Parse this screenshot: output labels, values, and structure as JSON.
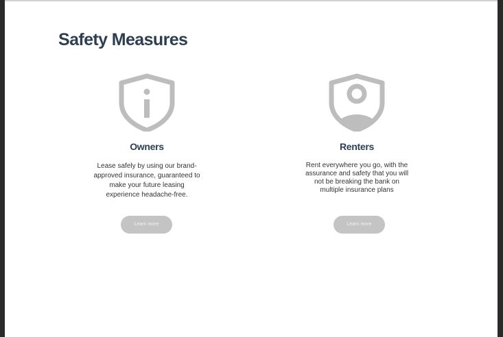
{
  "page": {
    "title": "Safety Measures"
  },
  "cards": [
    {
      "icon": "info-shield-icon",
      "title": "Owners",
      "description": "Lease safely by using our brand-approved insurance, guaranteed to make your future leasing experience headache-free.",
      "button_label": "Learn more"
    },
    {
      "icon": "user-shield-icon",
      "title": "Renters",
      "description": "Rent everywhere you go, with the assurance and safety that you will not be breaking the bank on multiple insurance plans",
      "button_label": "Learn more"
    }
  ],
  "colors": {
    "title": "#2c3e50",
    "icon": "#bdbdbd",
    "button": "#c4c4c4"
  }
}
